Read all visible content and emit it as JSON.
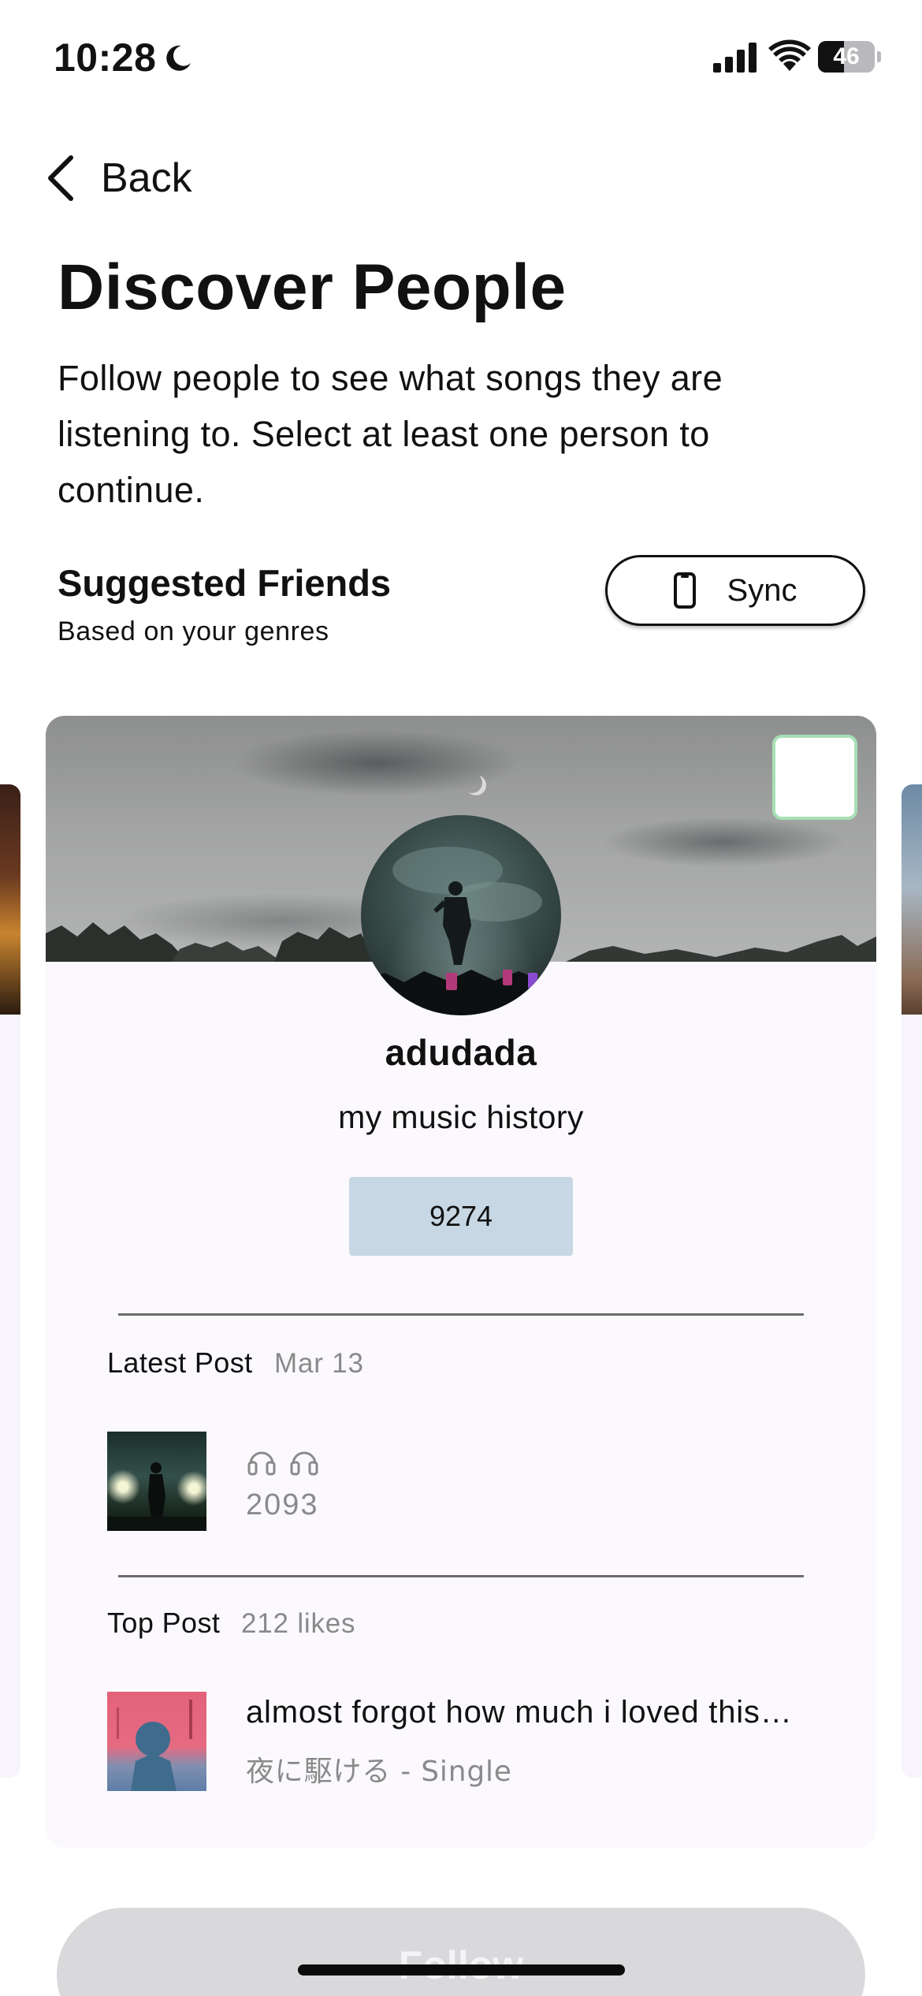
{
  "status_bar": {
    "time": "10:28",
    "battery_level": "46",
    "battery_fraction": 0.46
  },
  "nav": {
    "back_label": "Back"
  },
  "header": {
    "title": "Discover People",
    "description": "Follow people to see what songs they are listening to. Select at least one person to continue."
  },
  "suggested": {
    "title": "Suggested Friends",
    "subtitle": "Based on your genres",
    "sync_label": "Sync"
  },
  "card": {
    "username": "adudada",
    "bio": "my music history",
    "stat": "9274",
    "selected": false,
    "latest_post": {
      "label": "Latest Post",
      "date": "Mar 13",
      "listen_count": "2093"
    },
    "top_post": {
      "label": "Top Post",
      "likes": "212 likes",
      "title": "almost forgot how much i loved this song",
      "subtitle": "夜に駆ける - Single"
    }
  },
  "follow_button": {
    "label": "Follow"
  },
  "colors": {
    "stat_badge": "#c7d8e4",
    "checkbox_border": "#a7e0b5",
    "follow_disabled": "#d9d9dc"
  }
}
